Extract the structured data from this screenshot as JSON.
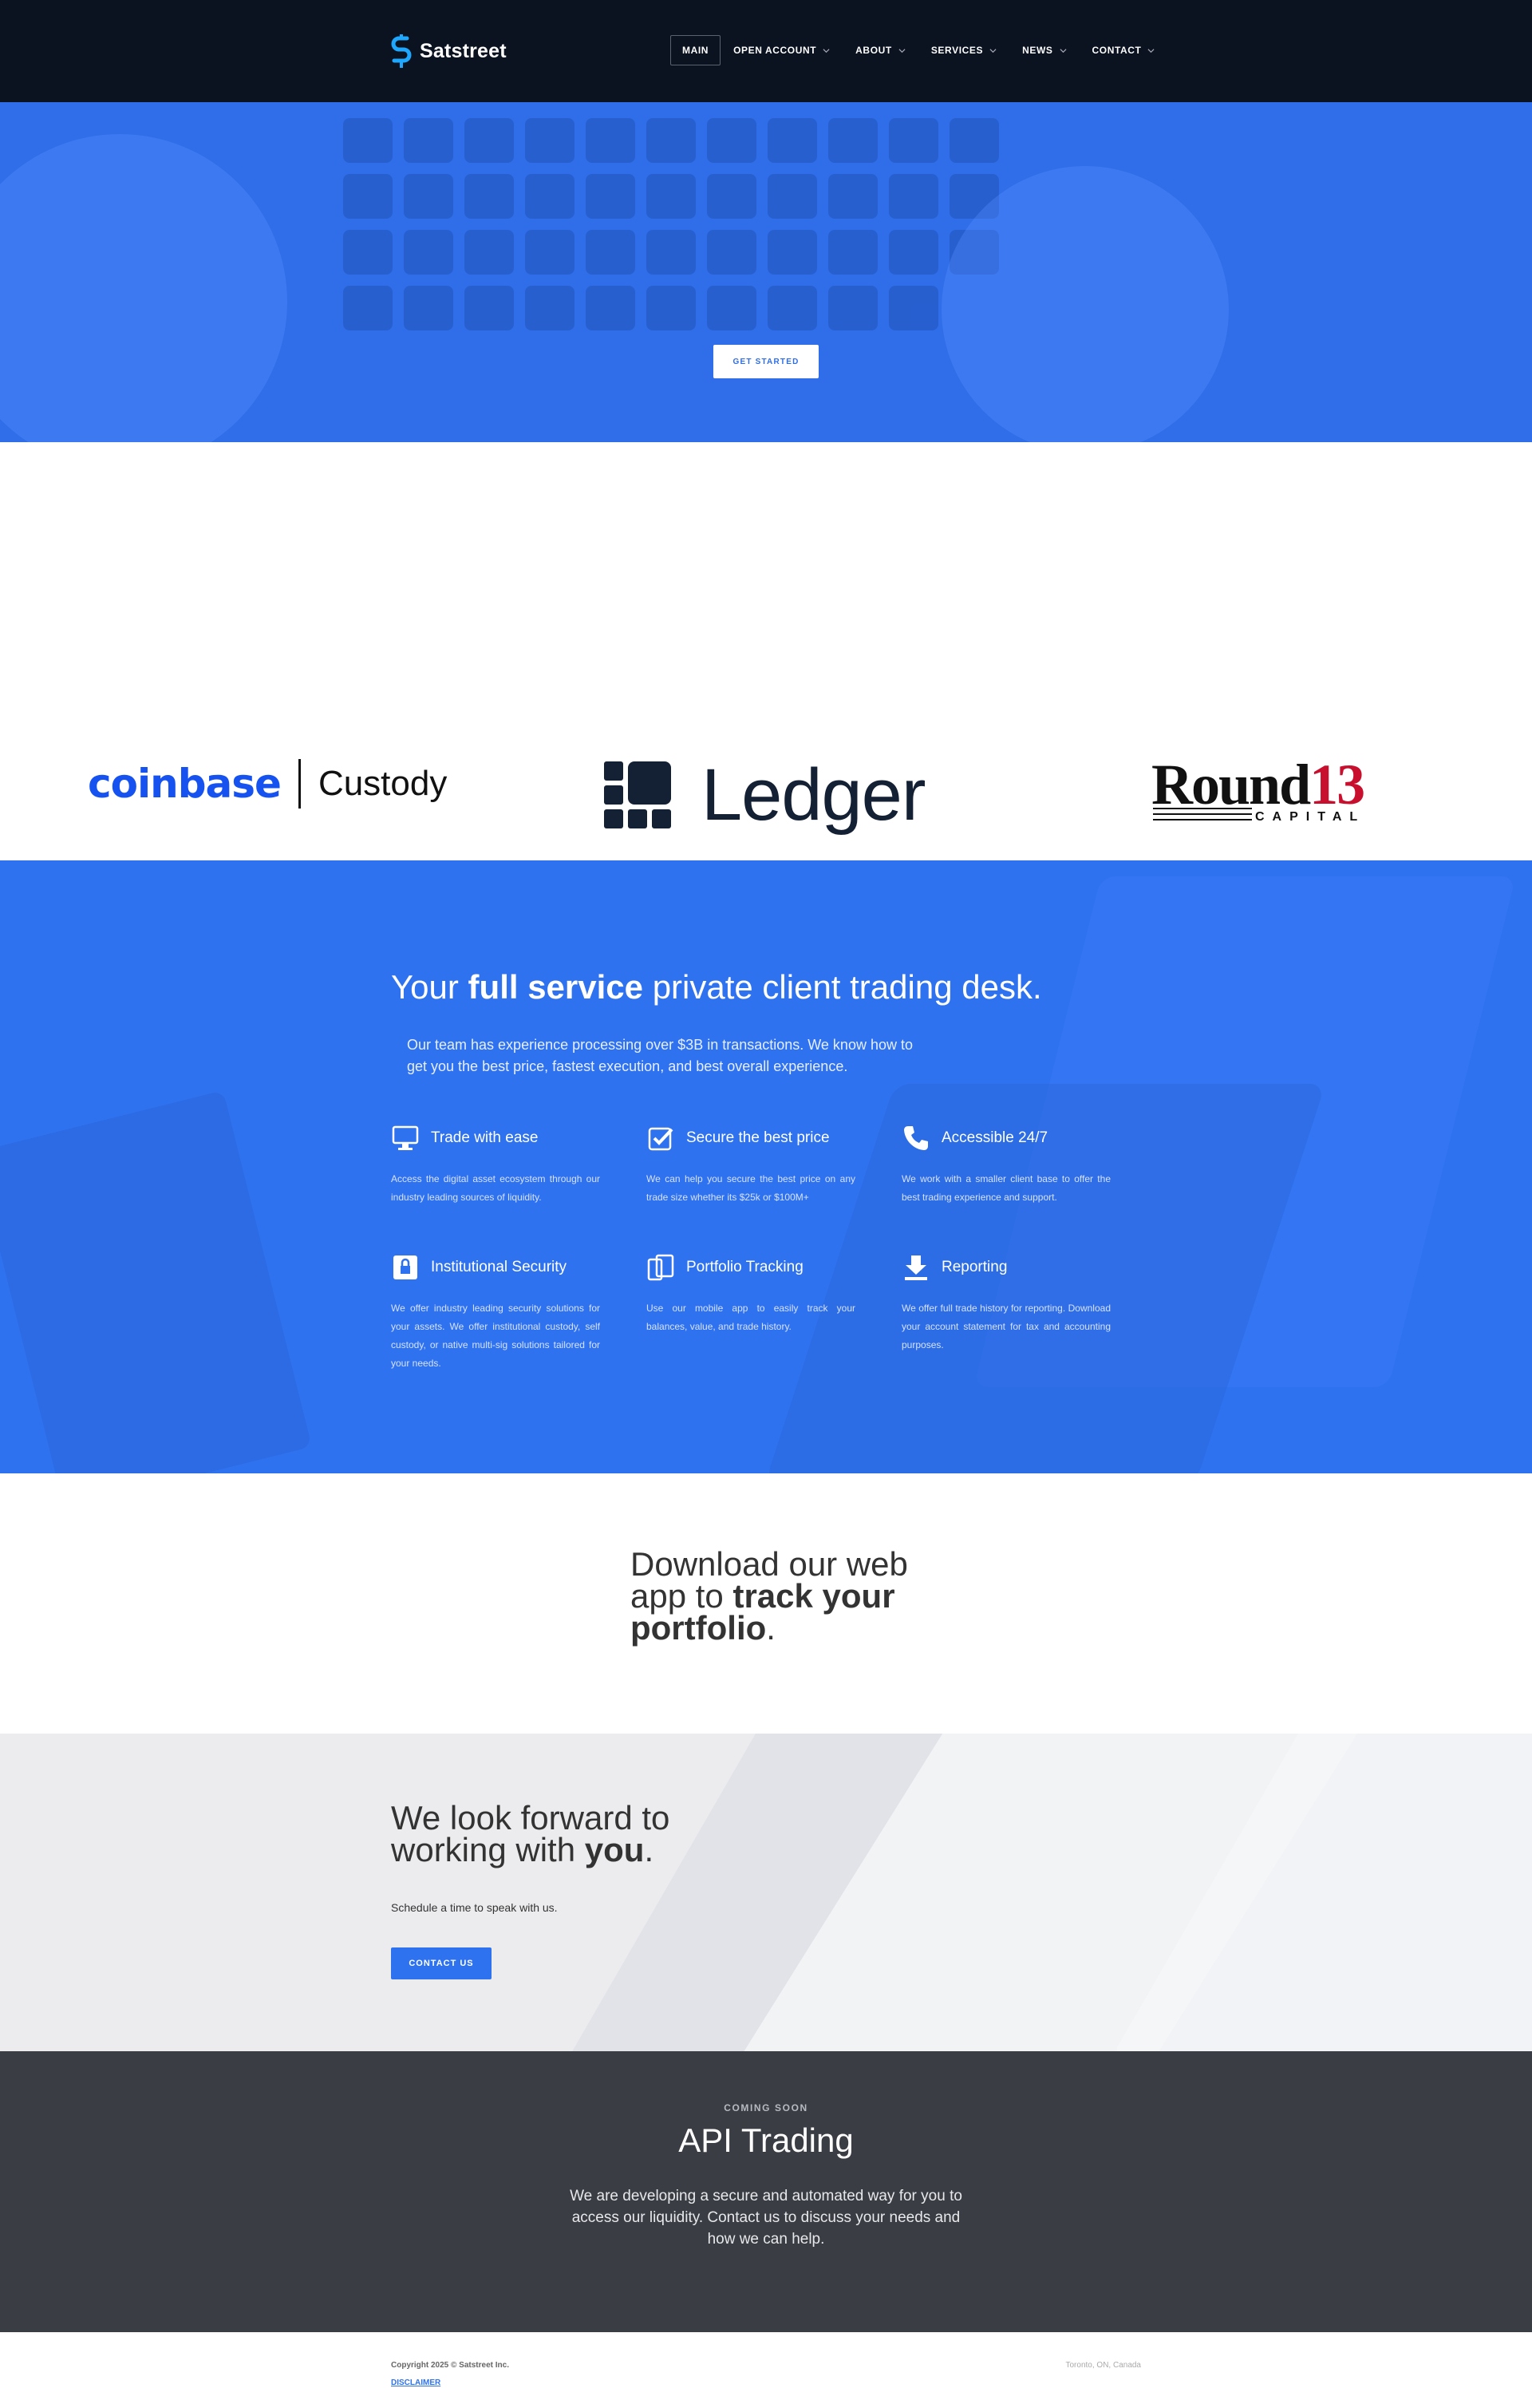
{
  "brand": {
    "name": "Satstreet"
  },
  "nav": [
    {
      "label": "Main",
      "active": true,
      "dropdown": false
    },
    {
      "label": "Open Account",
      "active": false,
      "dropdown": true
    },
    {
      "label": "About",
      "active": false,
      "dropdown": true
    },
    {
      "label": "Services",
      "active": false,
      "dropdown": true
    },
    {
      "label": "News",
      "active": false,
      "dropdown": true
    },
    {
      "label": "Contact",
      "active": false,
      "dropdown": true
    }
  ],
  "hero": {
    "cta_label": "GET STARTED"
  },
  "partners": {
    "coinbase": {
      "brand": "coinbase",
      "product": "Custody"
    },
    "ledger": {
      "brand": "Ledger"
    },
    "round13": {
      "main": "Round",
      "num": "13",
      "sub": "CAPITAL"
    }
  },
  "features": {
    "title_pre": "Your",
    "title_bold": "full service",
    "title_post": "private client trading desk.",
    "subtitle": "Our team has experience processing over $3B in transactions. We know how to get you the best price, fastest execution, and best overall experience.",
    "items": [
      {
        "icon": "monitor-icon",
        "title": "Trade with ease",
        "text": "Access the digital asset ecosystem through our industry leading sources of liquidity."
      },
      {
        "icon": "checkbox-icon",
        "title": "Secure the best price",
        "text": "We can help you secure the best price on any trade size whether its $25k or $100M+"
      },
      {
        "icon": "phone-icon",
        "title": "Accessible 24/7",
        "text": "We work with a smaller client base to offer the best trading experience and support."
      },
      {
        "icon": "lock-icon",
        "title": "Institutional Security",
        "text": "We offer industry leading security solutions for your assets. We offer institutional custody, self custody, or native multi-sig solutions tailored for your needs."
      },
      {
        "icon": "tablet-icon",
        "title": "Portfolio Tracking",
        "text": "Use our mobile app to easily track your balances, value, and trade history."
      },
      {
        "icon": "download-icon",
        "title": "Reporting",
        "text": "We offer full trade history for reporting. Download your account statement for tax and accounting purposes."
      }
    ]
  },
  "download": {
    "line1": "Download our web",
    "line2_pre": "app to",
    "line2_bold": "track your",
    "line3_bold": "portfolio",
    "line3_post": "."
  },
  "contact": {
    "title_line1": "We look forward to",
    "title_line2_pre": "working with",
    "title_line2_bold": "you",
    "title_line2_post": ".",
    "subtitle": "Schedule a time to speak with us.",
    "cta_label": "CONTACT US"
  },
  "api": {
    "eyebrow": "COMING SOON",
    "title": "API Trading",
    "text": "We are developing a secure and automated way for you to access our liquidity. Contact us to discuss your needs and how we can help."
  },
  "footer": {
    "copyright": "Copyright 2025 © Satstreet Inc.",
    "disclaimer": "DISCLAIMER",
    "location": "Toronto, ON, Canada"
  },
  "colors": {
    "header_bg": "#0b1220",
    "accent": "#2f72f0",
    "api_bg": "#3a3d43"
  }
}
